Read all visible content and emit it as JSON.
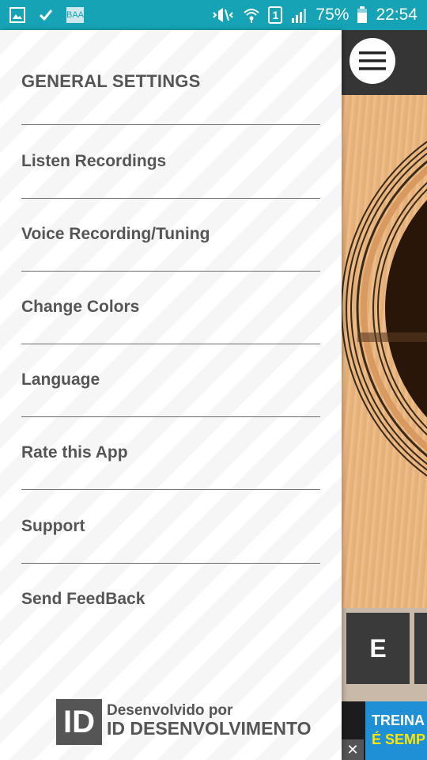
{
  "status_bar": {
    "battery_percent": "75%",
    "time": "22:54",
    "sim_slot": "1",
    "app_icon_label": "BAA",
    "left_icons": [
      "image-icon",
      "check-icon",
      "app-icon"
    ],
    "right_icons": [
      "mute-icon",
      "wifi-icon",
      "sim-icon",
      "signal-icon",
      "battery-icon"
    ],
    "color": "#16a3b5"
  },
  "drawer": {
    "title": "GENERAL SETTINGS",
    "items": [
      {
        "label": "Listen Recordings"
      },
      {
        "label": "Voice Recording/Tuning"
      },
      {
        "label": "Change Colors"
      },
      {
        "label": "Language"
      },
      {
        "label": "Rate this App"
      },
      {
        "label": "Support"
      },
      {
        "label": "Send FeedBack"
      }
    ],
    "footer": {
      "logo_text": "ID",
      "line1": "Desenvolvido por",
      "line2": "ID DESENVOLVIMENTO"
    }
  },
  "background_app": {
    "menu_icon": "hamburger-menu-icon",
    "note_key": "E",
    "ad": {
      "line1": "TREINA",
      "line2": "É SEMP",
      "close": "✕"
    }
  }
}
